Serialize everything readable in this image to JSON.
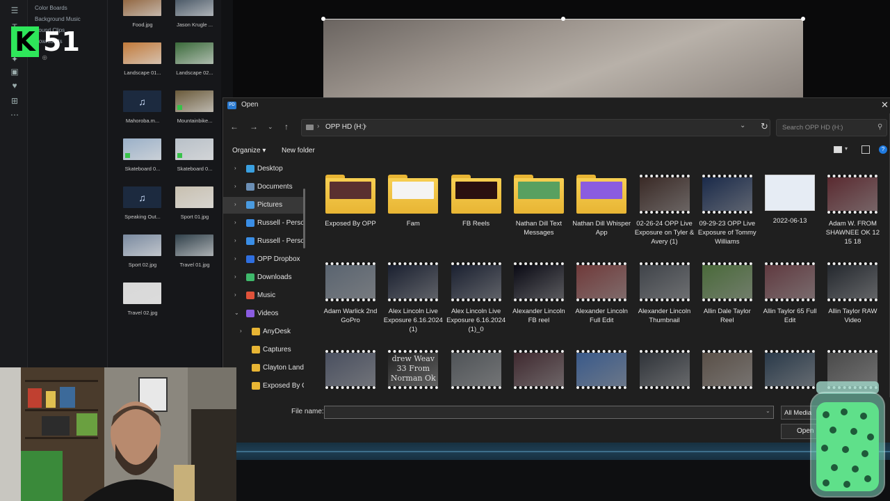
{
  "overlay": {
    "logo_letter": "K",
    "logo_number": "51"
  },
  "editor": {
    "menu_items": [
      "Color Boards",
      "Background Music",
      "Sound Clips",
      "Downloads"
    ],
    "media_library": [
      {
        "label": "Food.jpg",
        "kind": "image"
      },
      {
        "label": "Jason Krugle ...",
        "kind": "image"
      },
      {
        "label": "Landscape 01...",
        "kind": "image"
      },
      {
        "label": "Landscape 02...",
        "kind": "image"
      },
      {
        "label": "Mahoroba.m...",
        "kind": "music"
      },
      {
        "label": "Mountainbike...",
        "kind": "video"
      },
      {
        "label": "Skateboard 0...",
        "kind": "video"
      },
      {
        "label": "Skateboard 0...",
        "kind": "video"
      },
      {
        "label": "Speaking Out...",
        "kind": "music"
      },
      {
        "label": "Sport 01.jpg",
        "kind": "image"
      },
      {
        "label": "Sport 02.jpg",
        "kind": "image"
      },
      {
        "label": "Travel 01.jpg",
        "kind": "image"
      },
      {
        "label": "Travel 02.jpg",
        "kind": "image"
      }
    ]
  },
  "dialog": {
    "title": "Open",
    "address_drive": "OPP HD (H:)",
    "search_placeholder": "Search OPP HD (H:)",
    "organize_label": "Organize ▾",
    "new_folder_label": "New folder",
    "file_name_label": "File name:",
    "file_name_value": "",
    "filter_label": "All Media",
    "open_label": "Open",
    "nav_items": [
      {
        "label": "Desktop",
        "icon": "desktop-icon",
        "color": "#3aa0e0",
        "expand": "chevron-right",
        "indent": 0
      },
      {
        "label": "Documents",
        "icon": "documents-icon",
        "color": "#6b8fb5",
        "expand": "chevron-right",
        "indent": 0
      },
      {
        "label": "Pictures",
        "icon": "pictures-icon",
        "color": "#4a9be0",
        "expand": "chevron-right",
        "indent": 0,
        "selected": true
      },
      {
        "label": "Russell - Personal",
        "icon": "onedrive-icon",
        "color": "#3a8ee6",
        "expand": "chevron-right",
        "indent": 0
      },
      {
        "label": "Russell - Personal",
        "icon": "onedrive-icon",
        "color": "#3a8ee6",
        "expand": "chevron-right",
        "indent": 0
      },
      {
        "label": "OPP Dropbox",
        "icon": "dropbox-icon",
        "color": "#2f6fe0",
        "expand": "chevron-right",
        "indent": 0
      },
      {
        "label": "Downloads",
        "icon": "downloads-icon",
        "color": "#3fb96b",
        "expand": "chevron-right",
        "indent": 0
      },
      {
        "label": "Music",
        "icon": "music-icon",
        "color": "#e0523a",
        "expand": "chevron-right",
        "indent": 0
      },
      {
        "label": "Videos",
        "icon": "videos-icon",
        "color": "#8a5ce0",
        "expand": "chevron-down",
        "indent": 0
      },
      {
        "label": "AnyDesk",
        "icon": "folder-icon",
        "color": "#e8b534",
        "expand": "chevron-right",
        "indent": 1
      },
      {
        "label": "Captures",
        "icon": "folder-icon",
        "color": "#e8b534",
        "expand": "",
        "indent": 1
      },
      {
        "label": "Clayton Landers",
        "icon": "folder-icon",
        "color": "#e8b534",
        "expand": "",
        "indent": 1
      },
      {
        "label": "Exposed By OPP",
        "icon": "folder-icon",
        "color": "#e8b534",
        "expand": "",
        "indent": 1
      }
    ],
    "files": [
      {
        "label": "Exposed By OPP",
        "type": "folder",
        "tint": "#5a3030"
      },
      {
        "label": "Fam",
        "type": "folder",
        "tint": "#f4f4f4"
      },
      {
        "label": "FB Reels",
        "type": "folder",
        "tint": "#2a1010"
      },
      {
        "label": "Nathan Dill Text Messages",
        "type": "folder",
        "tint": "#58a060"
      },
      {
        "label": "Nathan Dill Whisper App",
        "type": "folder",
        "tint": "#8a5ce0"
      },
      {
        "label": "02-26-24 OPP Live Exposure on Tyler & Avery (1)",
        "type": "video",
        "tint": "#3a2a26"
      },
      {
        "label": "09-29-23 OPP Live Exposure of Tommy Williams",
        "type": "video",
        "tint": "#1a2a4a"
      },
      {
        "label": "2022-06-13",
        "type": "photo",
        "tint": "#e6ecf4"
      },
      {
        "label": "Adam W. FROM SHAWNEE OK 12 15 18",
        "type": "video",
        "tint": "#5a2a30"
      },
      {
        "label": "Adam Warlick 2nd GoPro",
        "type": "video",
        "tint": "#5a6470"
      },
      {
        "label": "Alex Lincoln Live Exposure 6.16.2024 (1)",
        "type": "video",
        "tint": "#1a2030"
      },
      {
        "label": "Alex Lincoln Live Exposure 6.16.2024 (1)_0",
        "type": "video",
        "tint": "#1a2030"
      },
      {
        "label": "Alexander Lincoln FB reel",
        "type": "video",
        "tint": "#0a0a14"
      },
      {
        "label": "Alexander Lincoln Full Edit",
        "type": "video",
        "tint": "#703a3a"
      },
      {
        "label": "Alexander Lincoln Thumbnail",
        "type": "video",
        "tint": "#40444a"
      },
      {
        "label": "Allin Dale Taylor Reel",
        "type": "video",
        "tint": "#4a6a3a"
      },
      {
        "label": "Allin Taylor 65 Full Edit",
        "type": "video",
        "tint": "#603a40"
      },
      {
        "label": "Allin Taylor RAW Video",
        "type": "video",
        "tint": "#24282e"
      },
      {
        "label": "",
        "type": "video",
        "tint": "#4a5060"
      },
      {
        "label": "",
        "type": "video",
        "tint": "#222",
        "overlay_text": "drew Weav 33 From Norman Ok"
      },
      {
        "label": "",
        "type": "video",
        "tint": "#505458"
      },
      {
        "label": "",
        "type": "video",
        "tint": "#402a30"
      },
      {
        "label": "",
        "type": "video",
        "tint": "#3a5a8a"
      },
      {
        "label": "",
        "type": "video",
        "tint": "#30343a"
      },
      {
        "label": "",
        "type": "video",
        "tint": "#5a5048"
      },
      {
        "label": "",
        "type": "video",
        "tint": "#2a3a4a"
      },
      {
        "label": "",
        "type": "video",
        "tint": "#4a4a4a"
      }
    ]
  }
}
